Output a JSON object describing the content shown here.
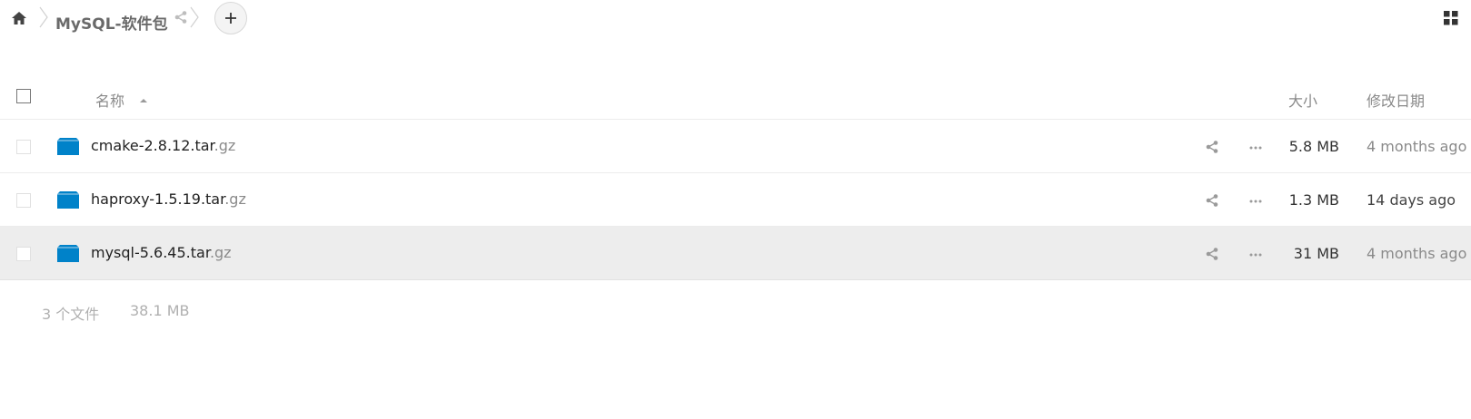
{
  "breadcrumb": {
    "home_icon": "home-icon",
    "folder_name": "MySQL-软件包",
    "share_icon": "share-icon",
    "add_icon": "plus-icon"
  },
  "view_toggle_icon": "grid-view-icon",
  "table": {
    "columns": {
      "name": "名称",
      "size": "大小",
      "modified": "修改日期"
    },
    "sort": {
      "column": "名称",
      "direction": "ascending"
    },
    "rows": [
      {
        "base": "cmake-2.8.12.tar",
        "ext": ".gz",
        "size": "5.8 MB",
        "modified": "4 months ago",
        "date_color": "#8a8a8a",
        "selected": false
      },
      {
        "base": "haproxy-1.5.19.tar",
        "ext": ".gz",
        "size": "1.3 MB",
        "modified": "14 days ago",
        "date_color": "#444444",
        "selected": false
      },
      {
        "base": "mysql-5.6.45.tar",
        "ext": ".gz",
        "size": "31 MB",
        "modified": "4 months ago",
        "date_color": "#8a8a8a",
        "selected": true
      }
    ]
  },
  "summary": {
    "count": "3 个文件",
    "total_size": "38.1 MB"
  },
  "colors": {
    "folder_icon": "#0082c9",
    "selected_row": "#ededed"
  }
}
